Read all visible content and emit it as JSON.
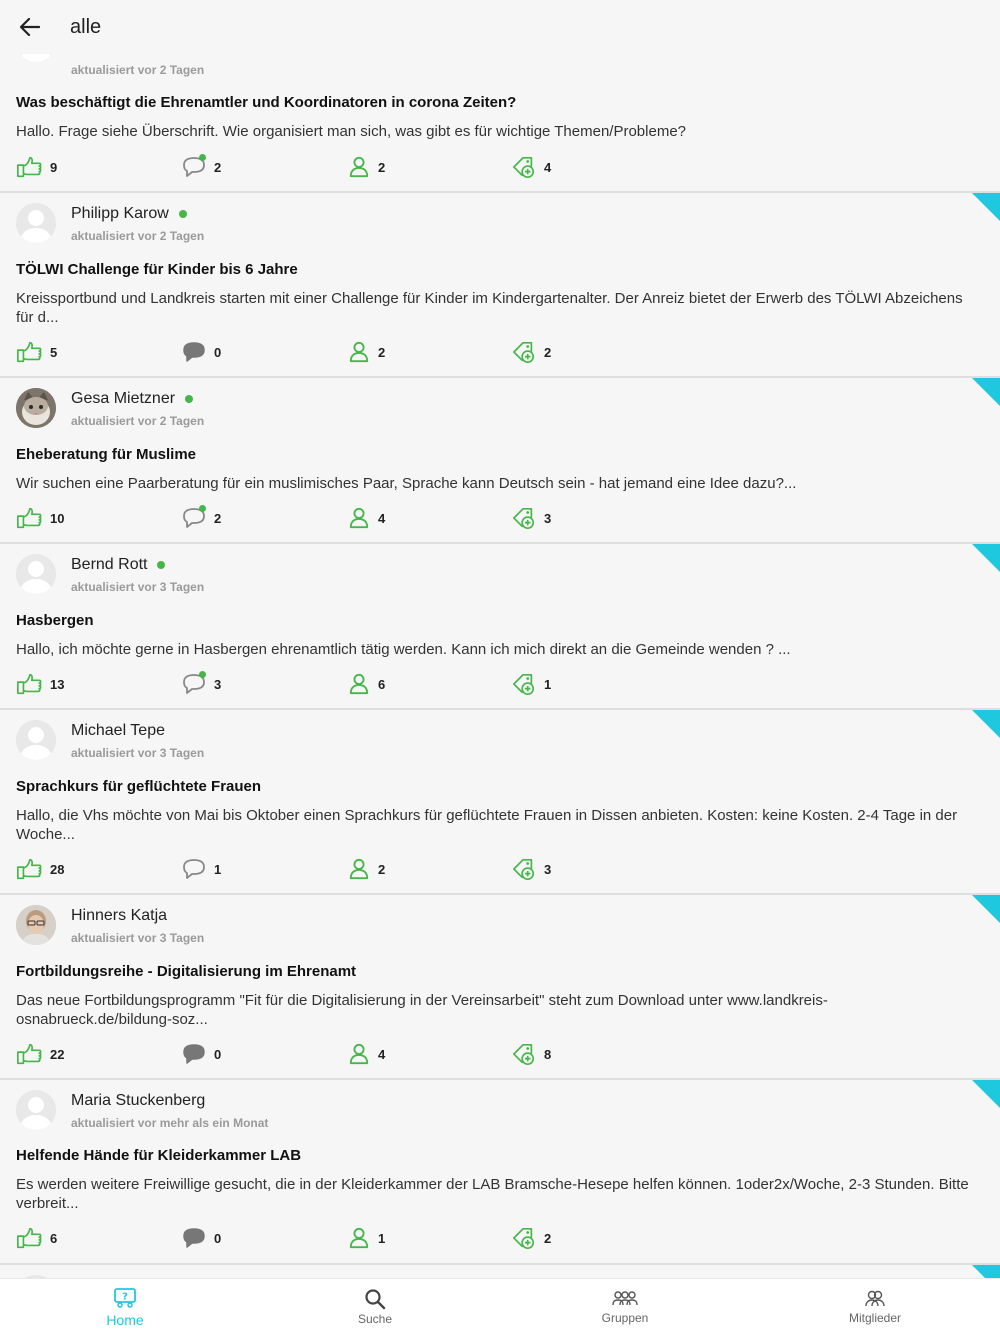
{
  "header": {
    "title": "alle"
  },
  "colors": {
    "accent": "#1ec8df",
    "green": "#45b649"
  },
  "posts": [
    {
      "updated": "aktualisiert vor 2 Tagen",
      "title": "Was beschäftigt die Ehrenamtler und Koordinatoren in corona Zeiten?",
      "body": "Hallo. Frage siehe Überschrift. Wie organisiert man sich, was gibt es für wichtige Themen/Probleme?",
      "likes": "9",
      "comments": "2",
      "members": "2",
      "tags": "4"
    },
    {
      "author": "Philipp Karow",
      "updated": "aktualisiert vor 2 Tagen",
      "title": "TÖLWI Challenge für Kinder bis 6 Jahre",
      "body": "Kreissportbund und Landkreis starten mit einer Challenge für Kinder im Kindergartenalter. Der Anreiz bietet der Erwerb des TÖLWI Abzeichens für d...",
      "likes": "5",
      "comments": "0",
      "members": "2",
      "tags": "2"
    },
    {
      "author": "Gesa Mietzner",
      "updated": "aktualisiert vor 2 Tagen",
      "title": "Eheberatung für Muslime",
      "body": "Wir suchen eine Paarberatung für ein muslimisches Paar, Sprache kann Deutsch sein - hat jemand eine Idee dazu?...",
      "likes": "10",
      "comments": "2",
      "members": "4",
      "tags": "3"
    },
    {
      "author": "Bernd Rott",
      "updated": "aktualisiert vor 3 Tagen",
      "title": "Hasbergen",
      "body": "Hallo, ich möchte gerne in Hasbergen ehrenamtlich tätig werden. Kann ich mich direkt an die Gemeinde wenden ? ...",
      "likes": "13",
      "comments": "3",
      "members": "6",
      "tags": "1"
    },
    {
      "author": "Michael Tepe",
      "updated": "aktualisiert vor 3 Tagen",
      "title": "Sprachkurs für geflüchtete Frauen",
      "body": "Hallo, die Vhs möchte von Mai bis Oktober einen Sprachkurs für geflüchtete Frauen in Dissen anbieten. Kosten: keine Kosten. 2-4 Tage in der Woche...",
      "likes": "28",
      "comments": "1",
      "members": "2",
      "tags": "3"
    },
    {
      "author": "Hinners Katja",
      "updated": "aktualisiert vor 3 Tagen",
      "title": "Fortbildungsreihe - Digitalisierung im Ehrenamt",
      "body": "Das neue Fortbildungsprogramm \"Fit für die Digitalisierung in der Vereinsarbeit\" steht zum Download unter www.landkreis-osnabrueck.de/bildung-soz...",
      "likes": "22",
      "comments": "0",
      "members": "4",
      "tags": "8"
    },
    {
      "author": "Maria Stuckenberg",
      "updated": "aktualisiert vor mehr als ein Monat",
      "title": "Helfende Hände für Kleiderkammer LAB",
      "body": "Es werden weitere Freiwillige gesucht, die in der Kleiderkammer der LAB Bramsche-Hesepe helfen können. 1oder2x/Woche, 2-3 Stunden. Bitte verbreit...",
      "likes": "6",
      "comments": "0",
      "members": "1",
      "tags": "2"
    }
  ],
  "nav": {
    "home": "Home",
    "search": "Suche",
    "groups": "Gruppen",
    "members": "Mitglieder"
  }
}
